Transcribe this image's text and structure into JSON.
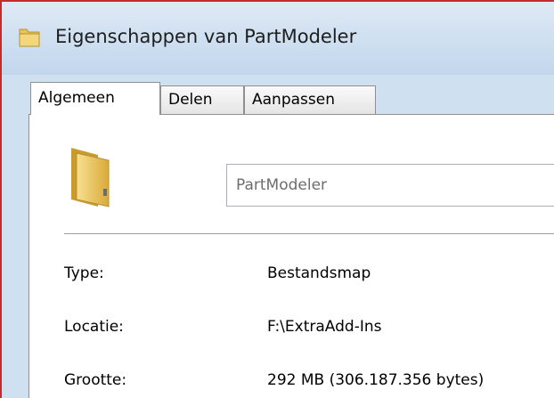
{
  "window": {
    "title": "Eigenschappen van PartModeler",
    "icon": "folder-icon",
    "accent_border": "#c42b2b"
  },
  "tabs": [
    {
      "label": "Algemeen",
      "active": true
    },
    {
      "label": "Delen",
      "active": false
    },
    {
      "label": "Aanpassen",
      "active": false
    }
  ],
  "general": {
    "folder_icon": "folder-icon",
    "name_value": "PartModeler",
    "properties": [
      {
        "label": "Type:",
        "value": "Bestandsmap"
      },
      {
        "label": "Locatie:",
        "value": "F:\\ExtraAdd-Ins"
      },
      {
        "label": "Grootte:",
        "value": "292 MB (306.187.356 bytes)"
      }
    ]
  }
}
